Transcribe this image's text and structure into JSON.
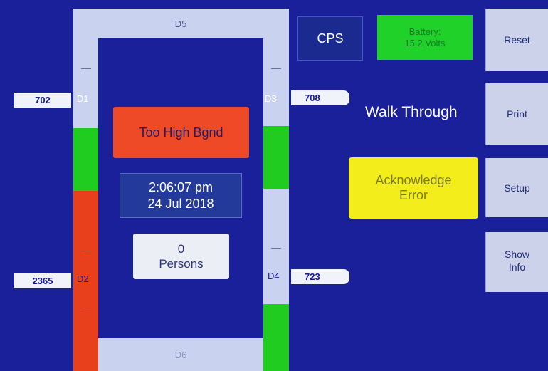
{
  "detectors": {
    "d1": {
      "label": "D1",
      "value": "702"
    },
    "d2": {
      "label": "D2",
      "value": "2365"
    },
    "d3": {
      "label": "D3",
      "value": "708"
    },
    "d4": {
      "label": "D4",
      "value": "723"
    },
    "d5": {
      "label": "D5"
    },
    "d6": {
      "label": "D6"
    }
  },
  "status": {
    "alarm": "Too High Bgnd",
    "time": "2:06:07 pm",
    "date": "24 Jul 2018",
    "persons_count": "0",
    "persons_label": "Persons"
  },
  "header": {
    "cps": "CPS",
    "battery_label": "Battery:",
    "battery_value": "15.2 Volts"
  },
  "mode": "Walk Through",
  "acknowledge": {
    "line1": "Acknowledge",
    "line2": "Error"
  },
  "side_buttons": {
    "reset": "Reset",
    "print": "Print",
    "setup": "Setup",
    "show_line1": "Show",
    "show_line2": "Info"
  },
  "colors": {
    "screen_bg": "#1a1f9a",
    "alarm_red": "#ee4a28",
    "ok_green": "#1fcc1f",
    "warning_yellow": "#f3ee1b",
    "panel_light": "#c9d2ef"
  }
}
